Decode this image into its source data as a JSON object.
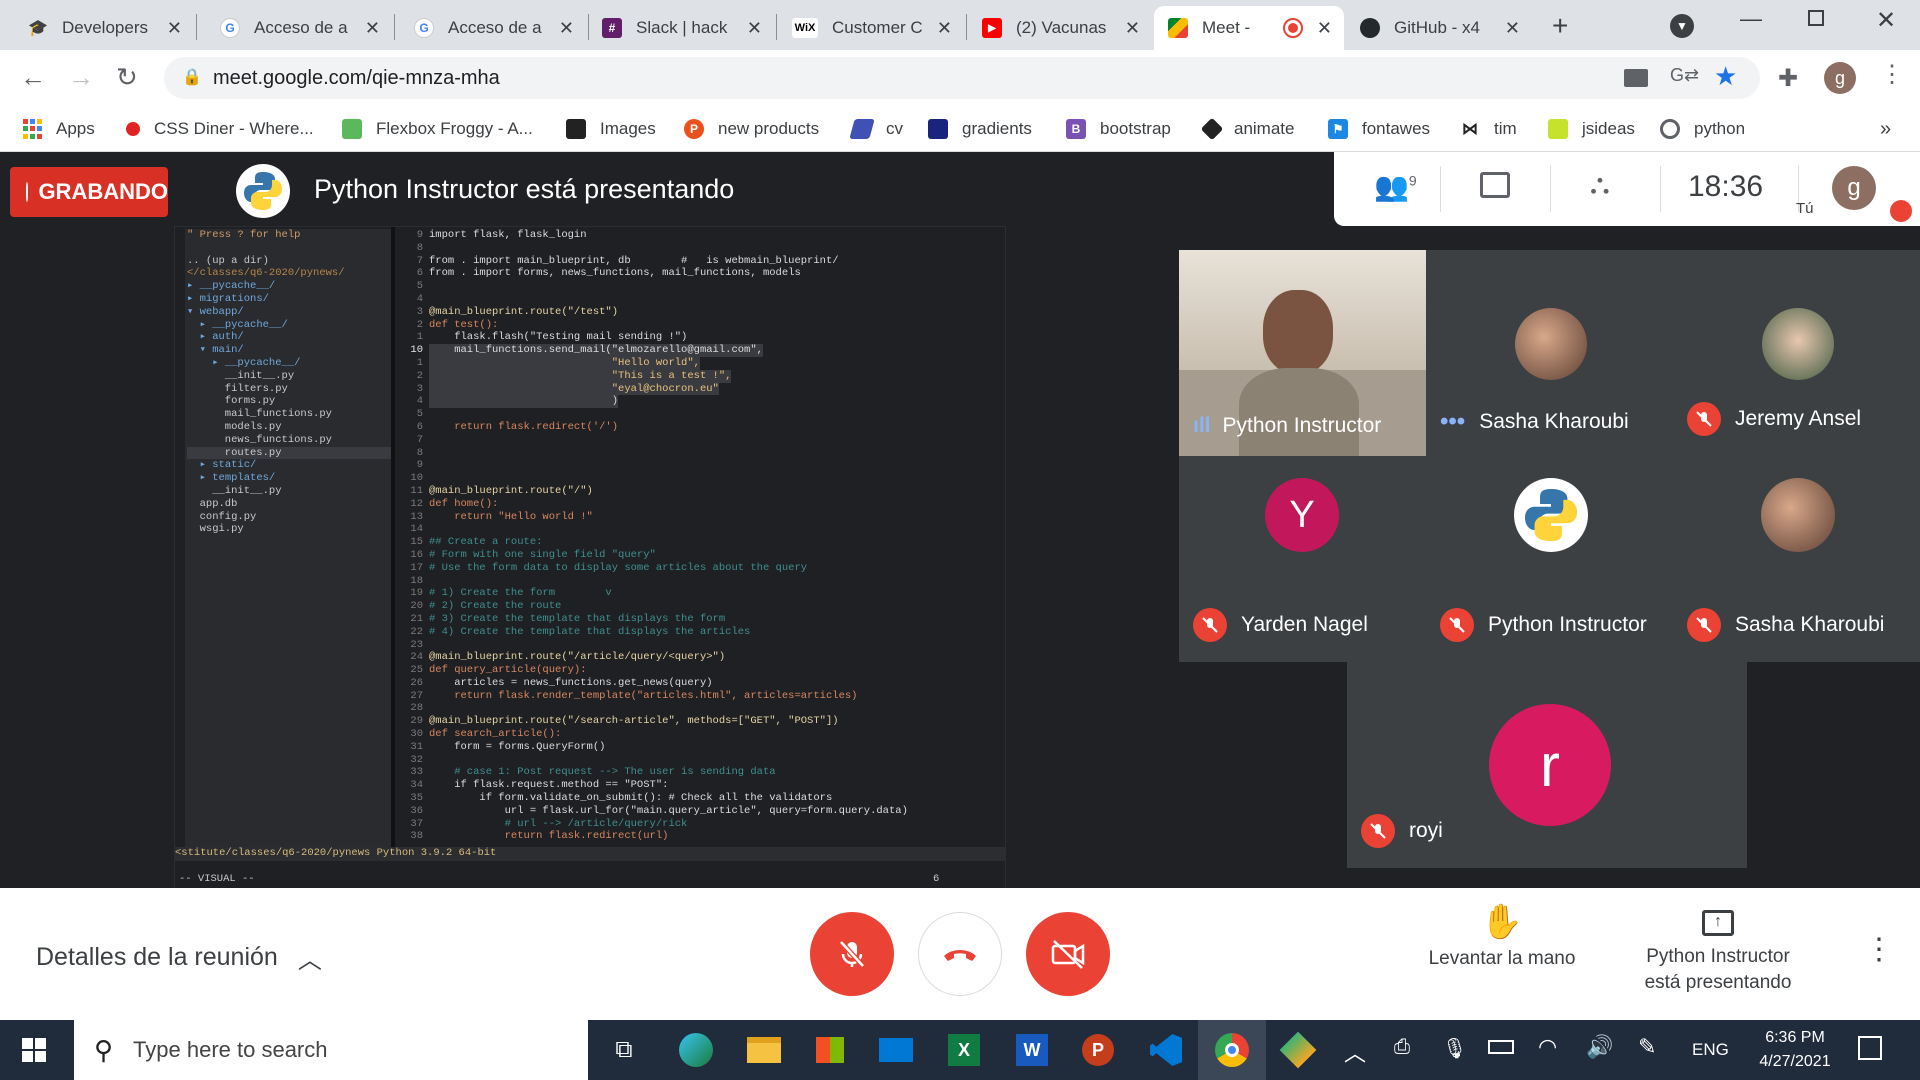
{
  "browser": {
    "tabs": [
      {
        "title": "Developers",
        "favicon": "graduation-cap"
      },
      {
        "title": "Acceso de a",
        "favicon": "google"
      },
      {
        "title": "Acceso de a",
        "favicon": "google"
      },
      {
        "title": "Slack | hack",
        "favicon": "slack"
      },
      {
        "title": "Customer C",
        "favicon": "wix"
      },
      {
        "title": "(2) Vacunas",
        "favicon": "youtube"
      },
      {
        "title": "Meet -",
        "favicon": "meet",
        "active": true
      },
      {
        "title": "GitHub - x4",
        "favicon": "github"
      }
    ],
    "url": "meet.google.com/qie-mnza-mha",
    "profile_initial": "g",
    "bookmarks": [
      "Apps",
      "CSS Diner - Where...",
      "Flexbox Froggy - A...",
      "Images",
      "new products",
      "cv",
      "gradients",
      "bootstrap",
      "animate",
      "fontawes",
      "tim",
      "jsideas",
      "python"
    ],
    "bookmarks_overflow": "»"
  },
  "meet": {
    "recording_label": "GRABANDO",
    "presenting_title": "Python Instructor está presentando",
    "time": "18:36",
    "participants_count": "9",
    "self_label": "Tú",
    "self_initial": "g",
    "participants": [
      {
        "name": "Python Instructor",
        "status": "speaking"
      },
      {
        "name": "Sasha Kharoubi",
        "status": "more"
      },
      {
        "name": "Jeremy Ansel",
        "status": "muted"
      },
      {
        "name": "Yarden Nagel",
        "status": "muted",
        "initial": "Y",
        "color": "#c2185b"
      },
      {
        "name": "Python Instructor",
        "status": "muted"
      },
      {
        "name": "Sasha Kharoubi",
        "status": "muted"
      },
      {
        "name": "royi",
        "status": "muted",
        "initial": "r",
        "color": "#d81b60"
      }
    ],
    "bottom": {
      "details_label": "Detalles de la reunión",
      "raise_hand_label": "Levantar la mano",
      "presenting_line1": "Python Instructor",
      "presenting_line2": "está presentando"
    }
  },
  "editor": {
    "tree": [
      "\" Press ? for help",
      "",
      ".. (up a dir)",
      "</classes/q6-2020/pynews/",
      "▸ __pycache__/",
      "▸ migrations/",
      "▾ webapp/",
      "  ▸ __pycache__/",
      "  ▸ auth/",
      "  ▾ main/",
      "    ▸ __pycache__/",
      "      __init__.py",
      "      filters.py",
      "      forms.py",
      "      mail_functions.py",
      "      models.py",
      "      news_functions.py",
      "      routes.py",
      "  ▸ static/",
      "  ▸ templates/",
      "    __init__.py",
      "  app.db",
      "  config.py",
      "  wsgi.py"
    ],
    "lines": [
      {
        "n": "9",
        "t": "import flask, flask_login"
      },
      {
        "n": "8",
        "t": ""
      },
      {
        "n": "7",
        "t": "from . import main_blueprint, db        #   is webmain_blueprint/"
      },
      {
        "n": "6",
        "t": "from . import forms, news_functions, mail_functions, models"
      },
      {
        "n": "5",
        "t": ""
      },
      {
        "n": "4",
        "t": ""
      },
      {
        "n": "3",
        "t": "@main_blueprint.route(\"/test\")"
      },
      {
        "n": "2",
        "t": "def test():"
      },
      {
        "n": "1",
        "t": "    flask.flash(\"Testing mail sending !\")"
      },
      {
        "n": "10",
        "t": "    mail_functions.send_mail(\"elmozarello@gmail.com\","
      },
      {
        "n": "1",
        "t": "                             \"Hello world\","
      },
      {
        "n": "2",
        "t": "                             \"This is a test !\","
      },
      {
        "n": "3",
        "t": "                             \"eyal@chocron.eu\""
      },
      {
        "n": "4",
        "t": "                             )"
      },
      {
        "n": "5",
        "t": ""
      },
      {
        "n": "6",
        "t": "    return flask.redirect('/')"
      },
      {
        "n": "7",
        "t": ""
      },
      {
        "n": "8",
        "t": ""
      },
      {
        "n": "9",
        "t": ""
      },
      {
        "n": "10",
        "t": ""
      },
      {
        "n": "11",
        "t": "@main_blueprint.route(\"/\")"
      },
      {
        "n": "12",
        "t": "def home():"
      },
      {
        "n": "13",
        "t": "    return \"Hello world !\""
      },
      {
        "n": "14",
        "t": ""
      },
      {
        "n": "15",
        "t": "## Create a route:"
      },
      {
        "n": "16",
        "t": "# Form with one single field \"query\""
      },
      {
        "n": "17",
        "t": "# Use the form data to display some articles about the query"
      },
      {
        "n": "18",
        "t": ""
      },
      {
        "n": "19",
        "t": "# 1) Create the form        v"
      },
      {
        "n": "20",
        "t": "# 2) Create the route"
      },
      {
        "n": "21",
        "t": "# 3) Create the template that displays the form"
      },
      {
        "n": "22",
        "t": "# 4) Create the template that displays the articles"
      },
      {
        "n": "23",
        "t": ""
      },
      {
        "n": "24",
        "t": "@main_blueprint.route(\"/article/query/<query>\")"
      },
      {
        "n": "25",
        "t": "def query_article(query):"
      },
      {
        "n": "26",
        "t": "    articles = news_functions.get_news(query)"
      },
      {
        "n": "27",
        "t": "    return flask.render_template(\"articles.html\", articles=articles)"
      },
      {
        "n": "28",
        "t": ""
      },
      {
        "n": "29",
        "t": "@main_blueprint.route(\"/search-article\", methods=[\"GET\", \"POST\"])"
      },
      {
        "n": "30",
        "t": "def search_article():"
      },
      {
        "n": "31",
        "t": "    form = forms.QueryForm()"
      },
      {
        "n": "32",
        "t": ""
      },
      {
        "n": "33",
        "t": "    # case 1: Post request --> The user is sending data"
      },
      {
        "n": "34",
        "t": "    if flask.request.method == \"POST\":"
      },
      {
        "n": "35",
        "t": "        if form.validate_on_submit(): # Check all the validators"
      },
      {
        "n": "36",
        "t": "            url = flask.url_for(\"main.query_article\", query=form.query.data)"
      },
      {
        "n": "37",
        "t": "            # url --> /article/query/rick"
      },
      {
        "n": "38",
        "t": "            return flask.redirect(url)"
      }
    ],
    "statusline": "<stitute/classes/q6-2020/pynews Python 3.9.2 64-bit",
    "mode": "-- VISUAL --",
    "count": "6"
  },
  "taskbar": {
    "search_placeholder": "Type here to search",
    "language": "ENG",
    "time": "6:36 PM",
    "date": "4/27/2021"
  }
}
